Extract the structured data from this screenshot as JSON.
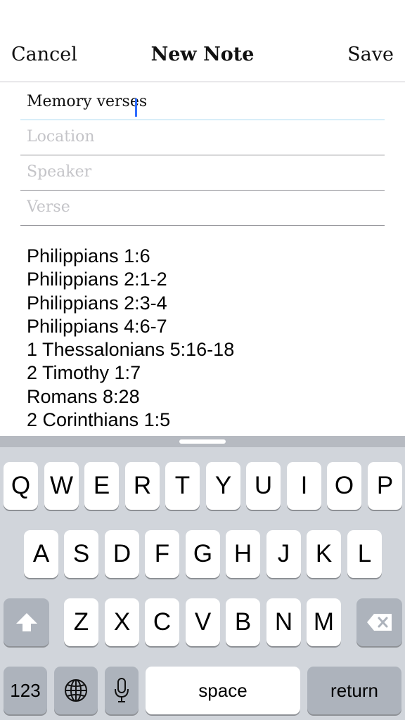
{
  "navbar": {
    "cancel_label": "Cancel",
    "title": "New Note",
    "save_label": "Save"
  },
  "form": {
    "title_value": "Memory verses",
    "location_placeholder": "Location",
    "speaker_placeholder": "Speaker",
    "verse_placeholder": "Verse"
  },
  "notes": {
    "lines": [
      "Philippians 1:6",
      "Philippians 2:1-2",
      "Philippians 2:3-4",
      "Philippians 4:6-7",
      "1 Thessalonians 5:16-18",
      "2 Timothy 1:7",
      "Romans 8:28",
      "2 Corinthians 1:5"
    ]
  },
  "keyboard": {
    "row1": [
      "Q",
      "W",
      "E",
      "R",
      "T",
      "Y",
      "U",
      "I",
      "O",
      "P"
    ],
    "row2": [
      "A",
      "S",
      "D",
      "F",
      "G",
      "H",
      "J",
      "K",
      "L"
    ],
    "row3": [
      "Z",
      "X",
      "C",
      "V",
      "B",
      "N",
      "M"
    ],
    "numbers_label": "123",
    "space_label": "space",
    "return_label": "return",
    "icons": {
      "shift": "shift-icon",
      "delete": "backspace-icon",
      "globe": "globe-icon",
      "mic": "microphone-icon"
    }
  },
  "colors": {
    "caret": "#2f6cff",
    "keyboard_bg": "#d1d5db",
    "dark_key": "#adb3bc",
    "placeholder": "#c4c4c8"
  }
}
